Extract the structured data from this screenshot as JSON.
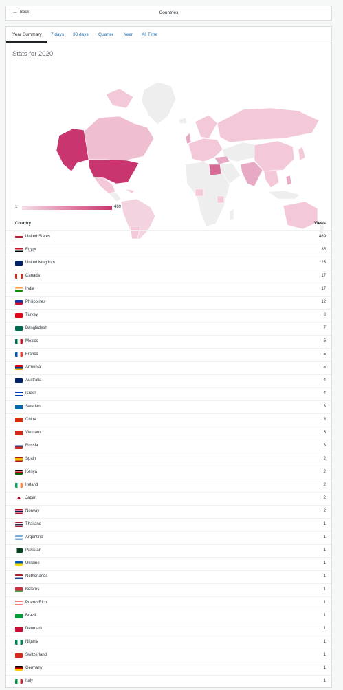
{
  "header": {
    "back_label": "Back",
    "title": "Countries"
  },
  "tabs": [
    {
      "label": "Year Summary",
      "active": true
    },
    {
      "label": "7 days"
    },
    {
      "label": "30 days"
    },
    {
      "label": "Quarter"
    },
    {
      "label": "Year"
    },
    {
      "label": "All Time"
    }
  ],
  "stats_title": "Stats for 2020",
  "legend": {
    "min": "1",
    "max": "469",
    "color_low": "#f5dde7",
    "color_high": "#c9356e"
  },
  "table": {
    "col_country": "Country",
    "col_views": "Views",
    "rows": [
      {
        "country": "United States",
        "views": "469",
        "flag": "us"
      },
      {
        "country": "Egypt",
        "views": "35",
        "flag": "eg"
      },
      {
        "country": "United Kingdom",
        "views": "23",
        "flag": "gb"
      },
      {
        "country": "Canada",
        "views": "17",
        "flag": "ca"
      },
      {
        "country": "India",
        "views": "17",
        "flag": "in"
      },
      {
        "country": "Philippines",
        "views": "12",
        "flag": "ph"
      },
      {
        "country": "Turkey",
        "views": "8",
        "flag": "tr"
      },
      {
        "country": "Bangladesh",
        "views": "7",
        "flag": "bd"
      },
      {
        "country": "Mexico",
        "views": "6",
        "flag": "mx"
      },
      {
        "country": "France",
        "views": "5",
        "flag": "fr"
      },
      {
        "country": "Armenia",
        "views": "5",
        "flag": "am"
      },
      {
        "country": "Australia",
        "views": "4",
        "flag": "au"
      },
      {
        "country": "Israel",
        "views": "4",
        "flag": "il"
      },
      {
        "country": "Sweden",
        "views": "3",
        "flag": "se"
      },
      {
        "country": "China",
        "views": "3",
        "flag": "cn"
      },
      {
        "country": "Vietnam",
        "views": "3",
        "flag": "vn"
      },
      {
        "country": "Russia",
        "views": "3",
        "flag": "ru"
      },
      {
        "country": "Spain",
        "views": "2",
        "flag": "es"
      },
      {
        "country": "Kenya",
        "views": "2",
        "flag": "ke"
      },
      {
        "country": "Ireland",
        "views": "2",
        "flag": "ie"
      },
      {
        "country": "Japan",
        "views": "2",
        "flag": "jp"
      },
      {
        "country": "Norway",
        "views": "2",
        "flag": "no"
      },
      {
        "country": "Thailand",
        "views": "1",
        "flag": "th"
      },
      {
        "country": "Argentina",
        "views": "1",
        "flag": "ar"
      },
      {
        "country": "Pakistan",
        "views": "1",
        "flag": "pk"
      },
      {
        "country": "Ukraine",
        "views": "1",
        "flag": "ua"
      },
      {
        "country": "Netherlands",
        "views": "1",
        "flag": "nl"
      },
      {
        "country": "Belarus",
        "views": "1",
        "flag": "by"
      },
      {
        "country": "Puerto Rico",
        "views": "1",
        "flag": "pr"
      },
      {
        "country": "Brazil",
        "views": "1",
        "flag": "br"
      },
      {
        "country": "Denmark",
        "views": "1",
        "flag": "dk"
      },
      {
        "country": "Nigeria",
        "views": "1",
        "flag": "ng"
      },
      {
        "country": "Switzerland",
        "views": "1",
        "flag": "ch"
      },
      {
        "country": "Germany",
        "views": "1",
        "flag": "de"
      },
      {
        "country": "Italy",
        "views": "1",
        "flag": "it"
      }
    ]
  }
}
